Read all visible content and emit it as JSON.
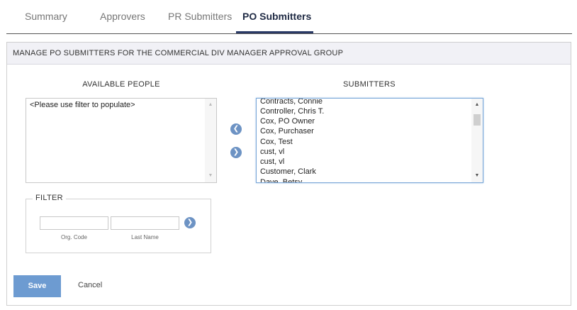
{
  "tabs": [
    {
      "label": "Summary",
      "active": false
    },
    {
      "label": "Approvers",
      "active": false
    },
    {
      "label": "PR Submitters",
      "active": false
    },
    {
      "label": "PO Submitters",
      "active": true
    }
  ],
  "panel": {
    "header": "MANAGE PO SUBMITTERS FOR THE COMMERCIAL DIV MANAGER APPROVAL GROUP"
  },
  "available": {
    "title": "AVAILABLE PEOPLE",
    "items": [
      "<Please use filter to populate>"
    ]
  },
  "submitters": {
    "title": "SUBMITTERS",
    "items": [
      "Contracts, Connie",
      "Controller, Chris T.",
      "Cox, PO Owner",
      "Cox, Purchaser",
      "Cox, Test",
      "cust, vl",
      "cust, vl",
      "Customer, Clark",
      "Dave, Betsy"
    ]
  },
  "filter": {
    "legend": "FILTER",
    "org_code_caption": "Org. Code",
    "last_name_caption": "Last Name",
    "org_code_value": "",
    "last_name_value": ""
  },
  "icons": {
    "move_left": "chevron-left-icon",
    "move_right": "chevron-right-icon",
    "filter_go": "chevron-right-icon"
  },
  "actions": {
    "save_label": "Save",
    "cancel_label": "Cancel"
  },
  "colors": {
    "accent": "#6d9bd1",
    "tab_active": "#1f2a44"
  }
}
